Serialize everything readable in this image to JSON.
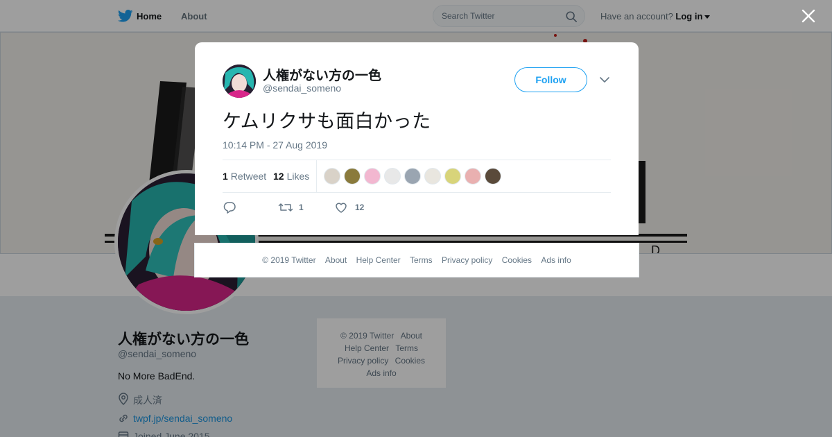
{
  "topnav": {
    "home_label": "Home",
    "about_label": "About",
    "search_placeholder": "Search Twitter",
    "account_prompt": "Have an account?",
    "login_label": "Log in"
  },
  "profile": {
    "name": "人権がない方の一色",
    "handle": "@sendai_someno",
    "bio": "No More BadEnd.",
    "location": "成人済",
    "url": "twpf.jp/sendai_someno",
    "joined": "Joined June 2015"
  },
  "side_footer": {
    "copyright": "© 2019 Twitter",
    "about": "About",
    "help": "Help Center",
    "terms": "Terms",
    "privacy": "Privacy policy",
    "cookies": "Cookies",
    "ads": "Ads info"
  },
  "tweet": {
    "author_name": "人権がない方の一色",
    "author_handle": "@sendai_someno",
    "follow_label": "Follow",
    "text": "ケムリクサも面白かった",
    "timestamp": "10:14 PM - 27 Aug 2019",
    "retweet_count": "1",
    "retweet_label": "Retweet",
    "like_count": "12",
    "like_label": "Likes",
    "action_retweet_count": "1",
    "action_like_count": "12",
    "liker_colors": [
      "#d9d2c8",
      "#8a7a3c",
      "#f2b7d0",
      "#e8e8e8",
      "#9aa5b1",
      "#e9e6df",
      "#d8d47a",
      "#e9b0b0",
      "#5a4a3a"
    ]
  },
  "modal_footer": {
    "copyright": "© 2019 Twitter",
    "about": "About",
    "help": "Help Center",
    "terms": "Terms",
    "privacy": "Privacy policy",
    "cookies": "Cookies",
    "ads": "Ads info"
  },
  "colors": {
    "accent": "#1da1f2",
    "link": "#1b95e0",
    "muted": "#657786"
  }
}
